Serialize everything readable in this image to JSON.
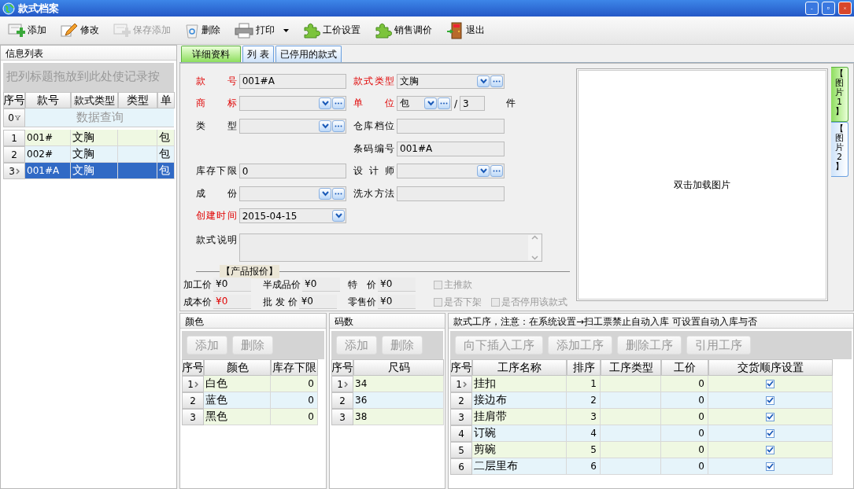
{
  "window": {
    "title": "款式档案"
  },
  "toolbar": [
    {
      "label": "添加",
      "disabled": false,
      "menu": false
    },
    {
      "label": "修改",
      "disabled": false,
      "menu": false
    },
    {
      "label": "保存添加",
      "disabled": true,
      "menu": false
    },
    {
      "label": "删除",
      "disabled": false,
      "menu": false
    },
    {
      "label": "打印",
      "disabled": false,
      "menu": true
    },
    {
      "label": "工价设置",
      "disabled": false,
      "menu": false
    },
    {
      "label": "销售调价",
      "disabled": false,
      "menu": false
    },
    {
      "label": "退出",
      "disabled": false,
      "menu": false
    }
  ],
  "info_list": {
    "title": "信息列表",
    "group_hint": "把列标题拖放到此处使记录按",
    "columns": [
      "序号",
      "款号",
      "款式类型",
      "类型",
      "单"
    ],
    "filter": {
      "no": "0",
      "hint": "数据查询"
    },
    "rows": [
      {
        "cells": [
          "1",
          "001#",
          "文胸",
          "",
          "包"
        ],
        "selected": false,
        "current": false
      },
      {
        "cells": [
          "2",
          "002#",
          "文胸",
          "",
          "包"
        ],
        "selected": false,
        "current": false
      },
      {
        "cells": [
          "3",
          "001#A",
          "文胸",
          "",
          "包"
        ],
        "selected": true,
        "current": true
      }
    ]
  },
  "tabs": [
    {
      "label": "详细资料",
      "selected": true
    },
    {
      "label": "列 表",
      "selected": false
    },
    {
      "label": "已停用的款式",
      "selected": false
    }
  ],
  "form": {
    "rows": [
      {
        "left": {
          "label": "款号",
          "required": true,
          "kind": "text",
          "value": "001#A"
        },
        "right": {
          "label": "款式类型",
          "required": true,
          "kind": "combo",
          "value": "文胸"
        }
      },
      {
        "left": {
          "label": "商标",
          "required": true,
          "kind": "combo"
        },
        "right": {
          "label": "单位",
          "required": true,
          "kind": "unit",
          "value": "包",
          "divider": "/",
          "qty": "3",
          "suffix": "件"
        }
      },
      {
        "left": {
          "label": "类型",
          "required": false,
          "kind": "combo"
        },
        "right": {
          "label": "仓库档位",
          "required": false,
          "kind": "text"
        }
      },
      {
        "right": {
          "label": "条码编号",
          "required": false,
          "kind": "text",
          "value": "001#A"
        }
      },
      {
        "left": {
          "label": "库存下限",
          "required": false,
          "kind": "text",
          "value": "0"
        },
        "right": {
          "label": "设计师",
          "required": false,
          "kind": "combo"
        }
      },
      {
        "left": {
          "label": "成份",
          "required": false,
          "kind": "combo"
        },
        "right": {
          "label": "洗水方法",
          "required": false,
          "kind": "text"
        }
      },
      {
        "left": {
          "label": "创建时间",
          "required": true,
          "kind": "date",
          "value": "2015-04-15"
        }
      }
    ],
    "description": {
      "label": "款式说明"
    }
  },
  "pricing": {
    "title": "【产品报价】",
    "prices": [
      {
        "label": "加工价",
        "value": "¥0",
        "highlight": false
      },
      {
        "label": "半成品价",
        "value": "¥0",
        "highlight": false
      },
      {
        "label": "特　价",
        "value": "¥0",
        "highlight": false
      },
      {
        "label": "成本价",
        "value": "¥0",
        "highlight": true
      },
      {
        "label": "批 发 价",
        "value": "¥0",
        "highlight": false
      },
      {
        "label": "零售价",
        "value": "¥0",
        "highlight": false
      }
    ],
    "checks": [
      {
        "label": "主推款",
        "checked": false,
        "disabled": true
      },
      {
        "label": "是否下架",
        "checked": false,
        "disabled": true
      },
      {
        "label": "是否停用该款式",
        "checked": false,
        "disabled": true
      }
    ]
  },
  "image": {
    "hint": "双击加载图片",
    "tabs": [
      {
        "label": "【图片1】",
        "selected": true
      },
      {
        "label": "【图片2】",
        "selected": false
      }
    ]
  },
  "colors": {
    "title": "颜色",
    "buttons": [
      "添加",
      "删除"
    ],
    "columns": [
      "序号",
      "颜色",
      "库存下限"
    ],
    "rows": [
      {
        "cells": [
          "1",
          "白色",
          "0"
        ],
        "current": true
      },
      {
        "cells": [
          "2",
          "蓝色",
          "0"
        ],
        "current": false
      },
      {
        "cells": [
          "3",
          "黑色",
          "0"
        ],
        "current": false
      }
    ]
  },
  "sizes": {
    "title": "码数",
    "buttons": [
      "添加",
      "删除"
    ],
    "columns": [
      "序号",
      "尺码"
    ],
    "rows": [
      {
        "cells": [
          "1",
          "34"
        ],
        "current": true
      },
      {
        "cells": [
          "2",
          "36"
        ],
        "current": false
      },
      {
        "cells": [
          "3",
          "38"
        ],
        "current": false
      }
    ]
  },
  "processes": {
    "title": "款式工序，注意：在系统设置→扫工票禁止自动入库 可设置自动入库与否",
    "buttons": [
      "向下插入工序",
      "添加工序",
      "删除工序",
      "引用工序"
    ],
    "columns": [
      "序号",
      "工序名称",
      "排序",
      "工序类型",
      "工价",
      "交货顺序设置"
    ],
    "rows": [
      {
        "cells": [
          "1",
          "挂扣",
          "1",
          "",
          "0"
        ],
        "checked": true,
        "current": true
      },
      {
        "cells": [
          "2",
          "接边布",
          "2",
          "",
          "0"
        ],
        "checked": true,
        "current": false
      },
      {
        "cells": [
          "3",
          "挂肩带",
          "3",
          "",
          "0"
        ],
        "checked": true,
        "current": false
      },
      {
        "cells": [
          "4",
          "订碗",
          "4",
          "",
          "0"
        ],
        "checked": true,
        "current": false
      },
      {
        "cells": [
          "5",
          "剪碗",
          "5",
          "",
          "0"
        ],
        "checked": true,
        "current": false
      },
      {
        "cells": [
          "6",
          "二层里布",
          "6",
          "",
          "0"
        ],
        "checked": true,
        "current": false
      }
    ]
  }
}
